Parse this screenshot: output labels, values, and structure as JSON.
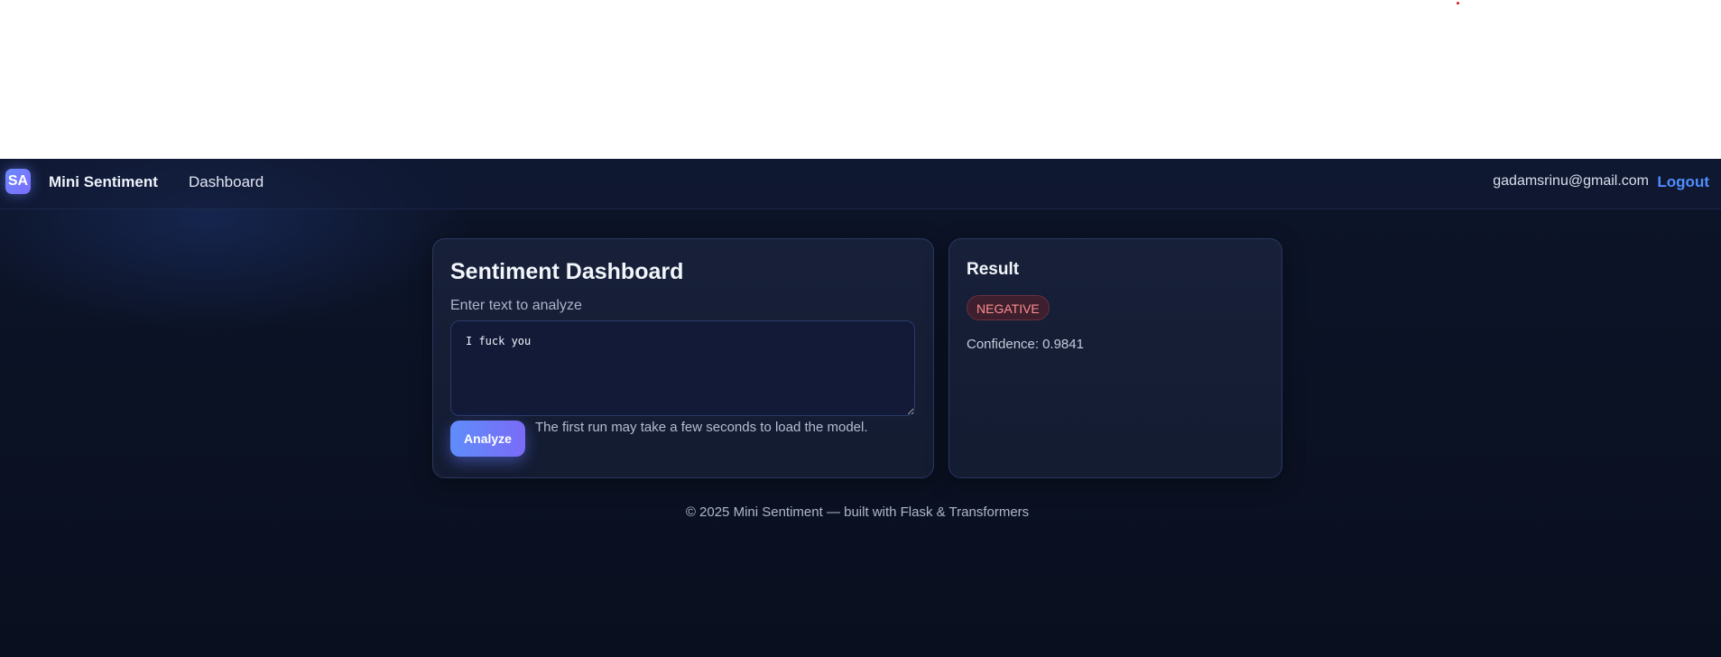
{
  "app": {
    "logo_text": "SA",
    "brand_name": "Mini Sentiment",
    "accent_color": "#4f8dff",
    "background_color": "#0b1224"
  },
  "navbar": {
    "links": [
      {
        "label": "Dashboard"
      }
    ],
    "user_email": "gadamsrinu@gmail.com",
    "logout_label": "Logout"
  },
  "dashboard": {
    "title": "Sentiment Dashboard",
    "input_label": "Enter text to analyze",
    "input_value": "I fuck you",
    "analyze_button_label": "Analyze",
    "hint": "The first run may take a few seconds to load the model."
  },
  "result": {
    "title": "Result",
    "sentiment_label": "NEGATIVE",
    "sentiment_color": "#ff8e8e",
    "confidence_label": "Confidence:",
    "confidence_value": "0.9841"
  },
  "footer": {
    "text": "© 2025 Mini Sentiment — built with Flask & Transformers"
  }
}
